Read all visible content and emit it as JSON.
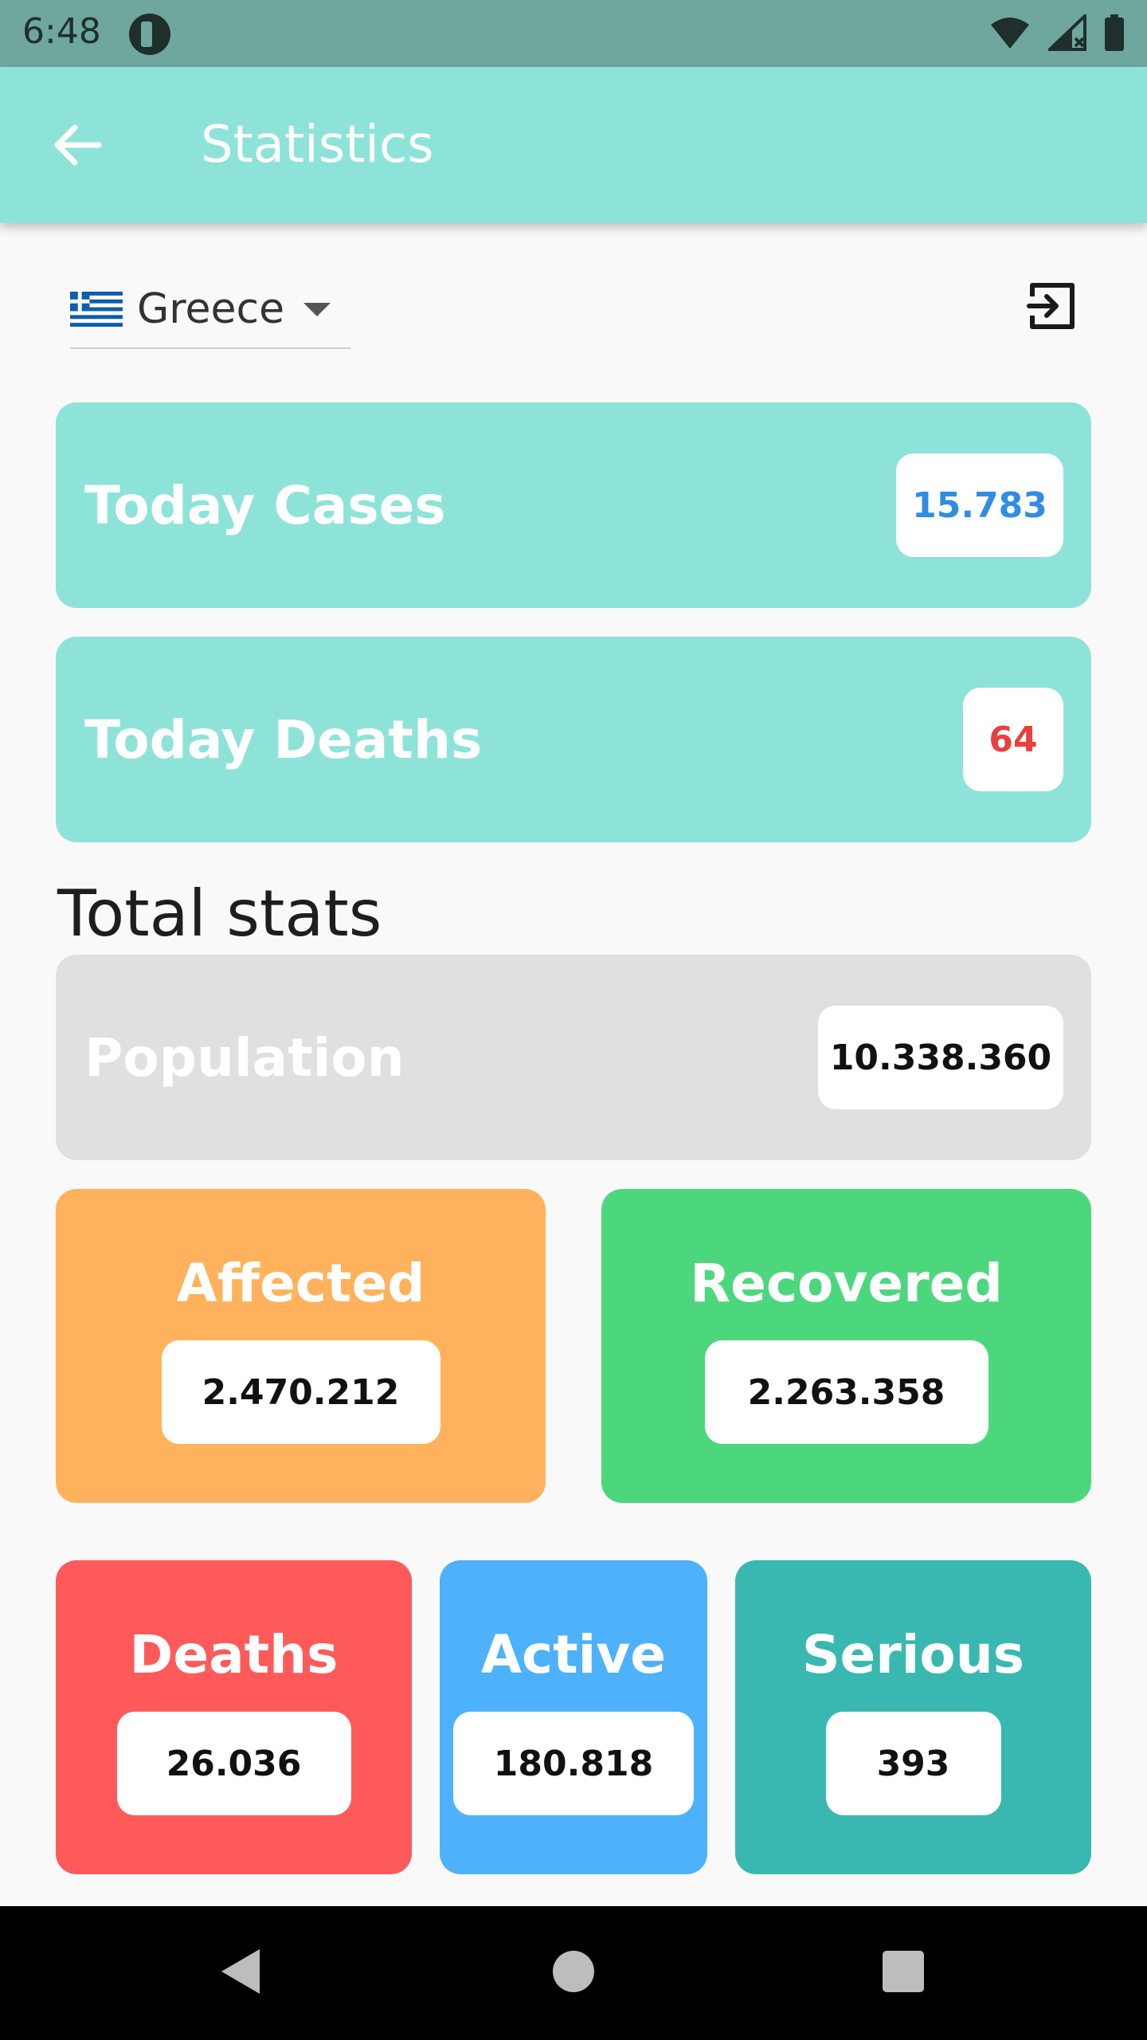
{
  "status_bar": {
    "time": "6:48"
  },
  "app_bar": {
    "title": "Statistics"
  },
  "country_selector": {
    "country": "Greece",
    "flag_icon": "greece-flag-icon"
  },
  "today": {
    "cases": {
      "label": "Today Cases",
      "value": "15.783",
      "value_color": "#2f8de4"
    },
    "deaths": {
      "label": "Today Deaths",
      "value": "64",
      "value_color": "#e8403c"
    }
  },
  "total_stats": {
    "heading": "Total stats",
    "population": {
      "label": "Population",
      "value": "10.338.360"
    },
    "affected": {
      "label": "Affected",
      "value": "2.470.212"
    },
    "recovered": {
      "label": "Recovered",
      "value": "2.263.358"
    },
    "deaths": {
      "label": "Deaths",
      "value": "26.036"
    },
    "active": {
      "label": "Active",
      "value": "180.818"
    },
    "serious": {
      "label": "Serious",
      "value": "393"
    }
  },
  "colors": {
    "app_bar": "#8ee3d8",
    "status_bar": "#6fa79e",
    "population_card": "#e0e0e0",
    "affected_card": "#ffb25b",
    "recovered_card": "#4cd77d",
    "deaths_card": "#fe5a5a",
    "active_card": "#4db1fc",
    "serious_card": "#38b8b0"
  }
}
